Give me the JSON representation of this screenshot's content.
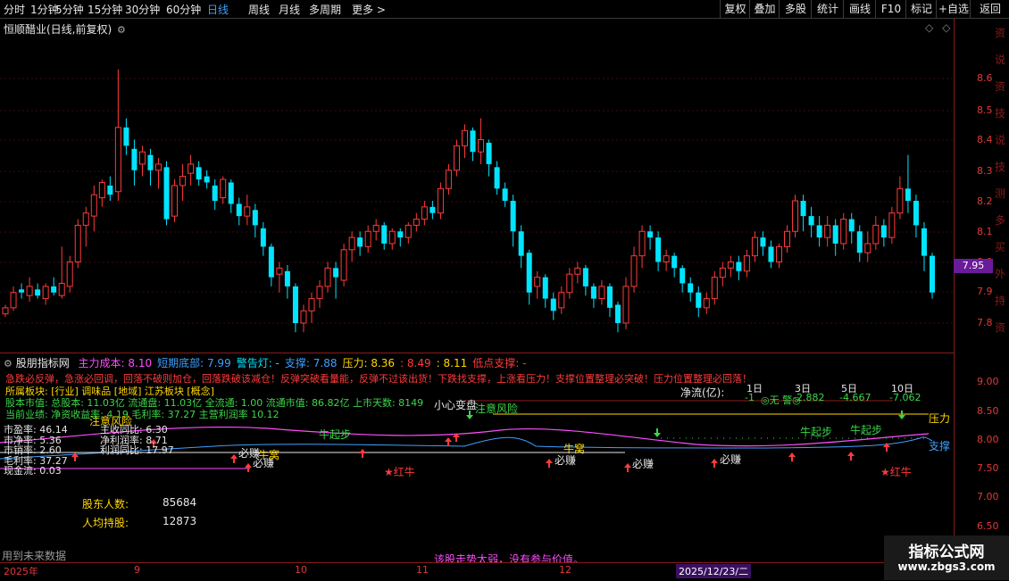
{
  "toolbar": {
    "periods": [
      "分时",
      "1分钟",
      "5分钟",
      "15分钟",
      "30分钟",
      "60分钟",
      "日线",
      "周线",
      "月线",
      "多周期",
      "更多 >"
    ],
    "active_period": "日线",
    "right_buttons": [
      "复权",
      "叠加",
      "多股",
      "统计",
      "画线",
      "F10",
      "标记",
      "+自选",
      "返回"
    ]
  },
  "price_panel": {
    "title": "恒顺醋业(日线,前复权)",
    "current_price": "7.95",
    "y_ticks": [
      "8.60",
      "8.50",
      "8.40",
      "8.30",
      "8.20",
      "8.10",
      "8.00",
      "7.90",
      "7.80"
    ]
  },
  "indicator": {
    "name": "股朋指标网",
    "legend": [
      {
        "label": "主力成本: 8.10",
        "color": "#ff4dff"
      },
      {
        "label": "短期底部: 7.99",
        "color": "#3fa0ff"
      },
      {
        "label": "警告灯: -",
        "color": "#00e5ff"
      },
      {
        "label": "支撑: 7.88",
        "color": "#3fa0ff"
      },
      {
        "label": "压力: 8.36",
        "color": "#ffd700"
      },
      {
        "label": ": 8.49",
        "color": "#ff3b3b"
      },
      {
        "label": ": 8.11",
        "color": "#ffd700"
      },
      {
        "label": "低点支撑: -",
        "color": "#ff3b3b"
      }
    ],
    "warning_line": "急跌必反弹，急涨必回调，回落不破则加仓，回落跌破该减仓！反弹突破看量能，反弹不过该出货！下跌找支撑，上涨看压力！支撑位置整理必突破！压力位置整理必回落！",
    "sector": "所属板块: [行业] 调味品 [地域] 江苏板块 [概念]",
    "equity": "股本市值: 总股本: 11.03亿 流通盘: 11.03亿 全流通: 1.00 流通市值: 86.82亿 上市天数: 8149",
    "performance": "当前业绩: 净资收益率: 4.19 毛利率: 37.27 主营利润率 10.12",
    "ratios_left": [
      "市盈率: 46.14",
      "市净率: 5.36",
      "市销率: 2.60",
      "毛利率: 37.27",
      "现金流: 0.03"
    ],
    "ratios_mid": [
      "主收同比: 6.30",
      "净利润率: 8.71",
      "利润同比: 17.97"
    ],
    "net_flow_label": "净流(亿):",
    "net_flow_periods": [
      "1日",
      "3日",
      "5日",
      "10日"
    ],
    "net_flow_values": [
      "-1",
      "-2.882",
      "-4.667",
      "-7.062"
    ],
    "flow_note": "◎无 警◎",
    "shareholders_label": "股东人数:",
    "shareholders_value": "85684",
    "per_capita_label": "人均持股:",
    "per_capita_value": "12873",
    "signals": {
      "risk1": "注意风险",
      "risk2": "小心变盘",
      "risk3": "注意风险",
      "bull_start": "牛起步",
      "bull_nest": "牛窝",
      "must_earn": "必赚",
      "red_bull": "★红牛",
      "pressure": "压力",
      "support": "支撑"
    },
    "y_ticks": [
      "9.00",
      "8.50",
      "8.00",
      "7.50",
      "7.00",
      "6.50"
    ],
    "footer_left": "用到未来数据",
    "footer_center": "该股走势太弱，没有参与价值。"
  },
  "date_axis": {
    "labels": [
      "2025年",
      "9",
      "10",
      "11",
      "12",
      "2025/12/23/二"
    ]
  },
  "right_strip_chars": [
    "资",
    "说",
    "资",
    "技",
    "说",
    "技",
    "测",
    "多",
    "买",
    "外",
    "持",
    "资"
  ],
  "watermark": {
    "line1": "指标公式网",
    "line2": "www.zbgs3.com"
  },
  "colors": {
    "up": "#ff3b3b",
    "down": "#00e5ff",
    "axis": "#8b1a1a",
    "active": "#3fa0ff"
  }
}
